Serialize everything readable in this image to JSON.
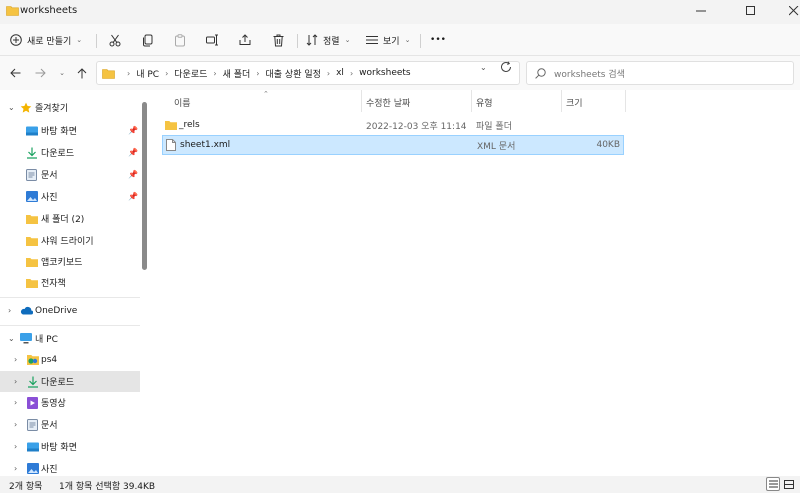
{
  "window": {
    "title": "worksheets"
  },
  "toolbar": {
    "new_label": "새로 만들기",
    "sort_label": "정렬",
    "view_label": "보기",
    "more_label": "•••"
  },
  "address": {
    "crumbs": [
      "내 PC",
      "다운로드",
      "새 폴더",
      "대출 상환 일정",
      "xl",
      "worksheets"
    ],
    "search_placeholder": "worksheets 검색"
  },
  "sidebar": {
    "quick_access": "즐겨찾기",
    "quick_items": [
      {
        "label": "바탕 화면",
        "icon": "desktop-icon",
        "pinned": true
      },
      {
        "label": "다운로드",
        "icon": "download-icon",
        "pinned": true
      },
      {
        "label": "문서",
        "icon": "document-icon",
        "pinned": true
      },
      {
        "label": "사진",
        "icon": "pictures-icon",
        "pinned": true
      },
      {
        "label": "새 폴더 (2)",
        "icon": "folder-icon",
        "pinned": false
      },
      {
        "label": "샤워 드라이기",
        "icon": "folder-icon",
        "pinned": false
      },
      {
        "label": "앱코키보드",
        "icon": "folder-icon",
        "pinned": false
      },
      {
        "label": "전자책",
        "icon": "folder-icon",
        "pinned": false
      }
    ],
    "onedrive": "OneDrive",
    "thispc": "내 PC",
    "pc_items": [
      {
        "label": "ps4",
        "icon": "drive-icon"
      },
      {
        "label": "다운로드",
        "icon": "download-icon",
        "selected": true
      },
      {
        "label": "동영상",
        "icon": "video-icon"
      },
      {
        "label": "문서",
        "icon": "document-icon"
      },
      {
        "label": "바탕 화면",
        "icon": "desktop-icon"
      },
      {
        "label": "사진",
        "icon": "pictures-icon"
      }
    ]
  },
  "columns": {
    "name": "이름",
    "date": "수정한 날짜",
    "type": "유형",
    "size": "크기"
  },
  "files": [
    {
      "name": "_rels",
      "date": "2022-12-03 오후 11:14",
      "type": "파일 폴더",
      "size": "",
      "icon": "folder-icon",
      "selected": false
    },
    {
      "name": "sheet1.xml",
      "date": "",
      "type": "XML 문서",
      "size": "40KB",
      "icon": "file-icon",
      "selected": true
    }
  ],
  "status": {
    "count": "2개 항목",
    "selection": "1개 항목 선택함 39.4KB"
  },
  "colors": {
    "folder": "#f5c342",
    "selected_bg": "#cce8ff",
    "accent": "#0067c0"
  }
}
